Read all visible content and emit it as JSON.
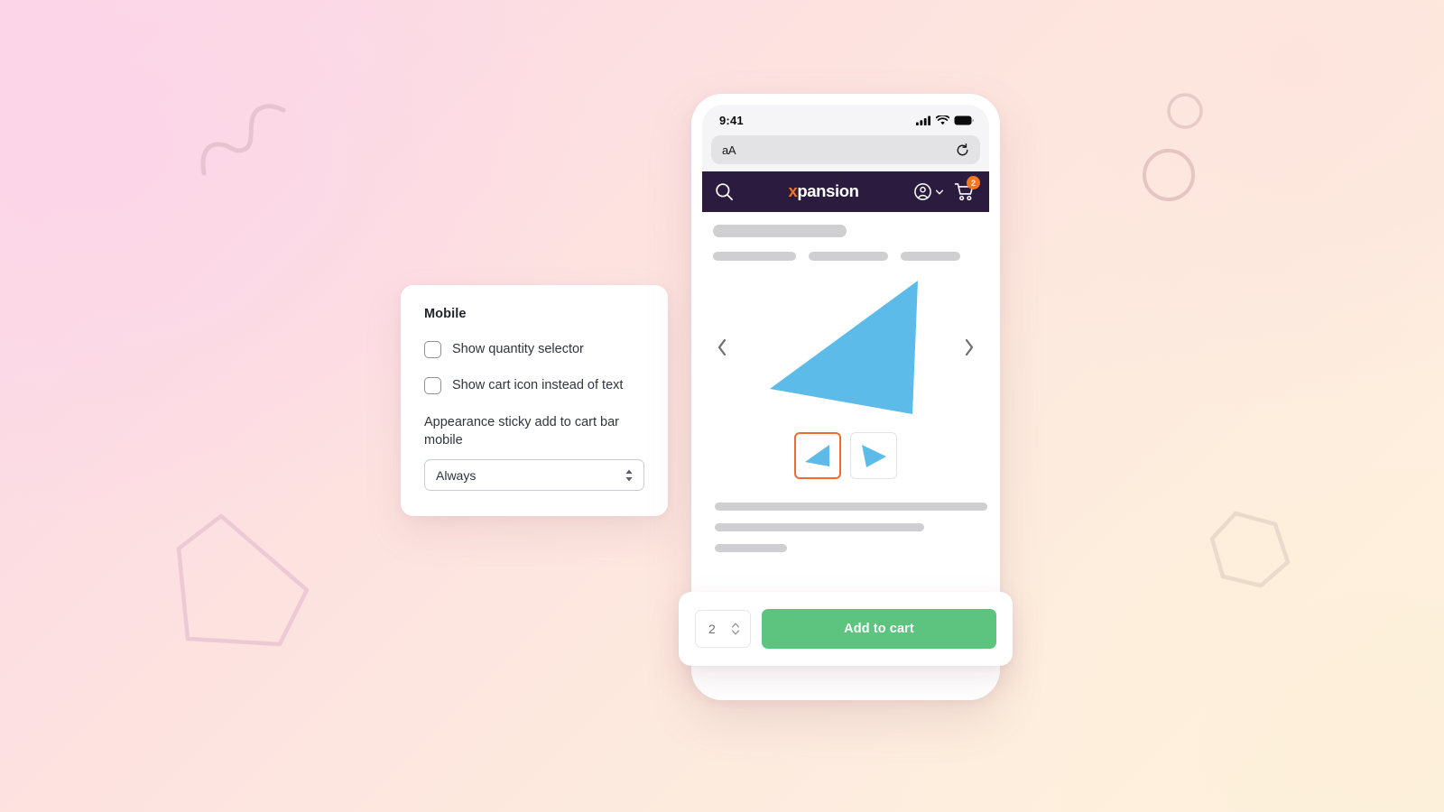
{
  "background": {
    "gradient_from": "#fbd6e7",
    "gradient_to": "#fef3e1",
    "shapes": [
      {
        "name": "squiggle-line",
        "color": "#e9c6d4"
      },
      {
        "name": "pentagon-outline",
        "color": "#edcbd6"
      },
      {
        "name": "circle-outline-small",
        "color": "#e9cbc8"
      },
      {
        "name": "circle-outline-large",
        "color": "#e6c6c4"
      },
      {
        "name": "hexagon-outline",
        "color": "#ecdccd"
      }
    ]
  },
  "settings_card": {
    "title": "Mobile",
    "checkboxes": [
      {
        "label": "Show quantity selector",
        "checked": false
      },
      {
        "label": "Show cart icon instead of text",
        "checked": false
      }
    ],
    "select": {
      "label": "Appearance sticky add to cart bar mobile",
      "value": "Always",
      "options": [
        "Always"
      ]
    }
  },
  "phone": {
    "status_bar": {
      "time": "9:41",
      "icons": [
        "cellular-signal-icon",
        "wifi-icon",
        "battery-icon"
      ]
    },
    "browser": {
      "aa_label": "aA",
      "reload_icon": "reload-icon"
    },
    "site_nav": {
      "search_icon": "search-icon",
      "brand_x": "x",
      "brand_rest": "pansion",
      "brand_accent": "#f4761f",
      "nav_background": "#2b1b3f",
      "account_icon": "account-circle-icon",
      "account_chevron": "chevron-down-icon",
      "cart_icon": "shopping-cart-icon",
      "cart_badge_count": "2",
      "cart_badge_color": "#f4761f"
    },
    "product": {
      "skeleton_title_width": 148,
      "skeleton_meta_widths": [
        92,
        88,
        66
      ],
      "main_image": "blue-triangle-placeholder",
      "main_image_color": "#5cbbe8",
      "carousel_prev_icon": "chevron-left-icon",
      "carousel_next_icon": "chevron-right-icon",
      "thumbnails": [
        {
          "name": "thumbnail-1",
          "selected": true
        },
        {
          "name": "thumbnail-2",
          "selected": false
        }
      ],
      "selected_thumb_border": "#ee6c32",
      "skeleton_desc_widths": [
        302,
        232,
        80
      ]
    }
  },
  "sticky_bar": {
    "quantity_value": "2",
    "stepper_icon": "stepper-arrows-icon",
    "add_to_cart_label": "Add to cart",
    "add_to_cart_color": "#5cc47e"
  }
}
